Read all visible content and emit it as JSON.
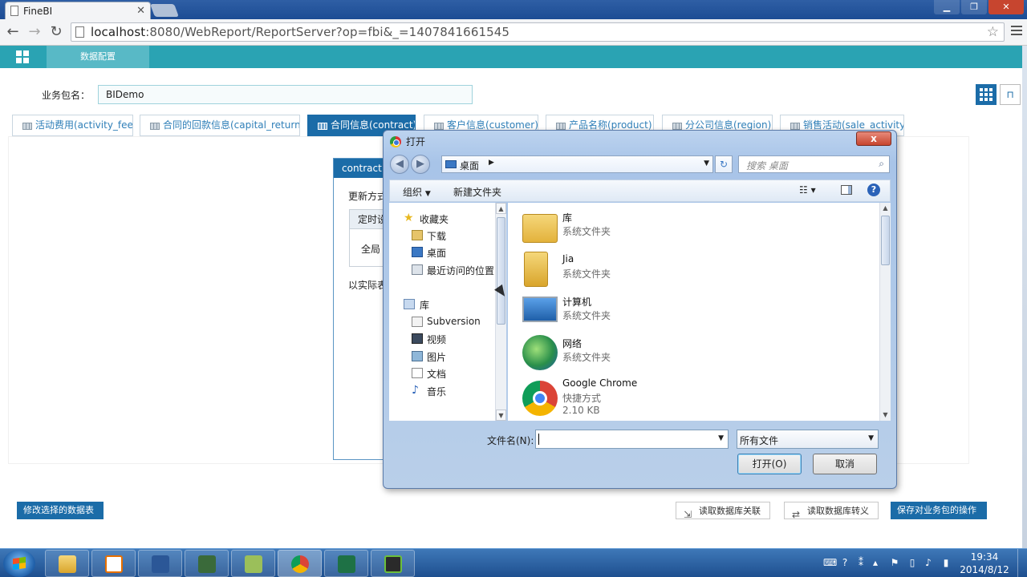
{
  "browser": {
    "tab_title": "FineBI",
    "url_host": "localhost",
    "url_rest": ":8080/WebReport/ReportServer?op=fbi&_=1407841661545"
  },
  "app": {
    "nav_tab": "数据配置",
    "package_label": "业务包名：",
    "package_name": "BIDemo",
    "table_tabs": [
      "活动费用(activity_fee)",
      "合同的回款信息(capital_return)",
      "合同信息(contract)",
      "客户信息(customer)",
      "产品名称(product)",
      "分公司信息(region)",
      "销售活动(sale_activity)"
    ],
    "active_tab_index": 2,
    "panel": {
      "header": "contract",
      "update_label": "更新方式",
      "box_header": "定时设",
      "box_body": "全局",
      "note": "以实际表"
    },
    "footer": {
      "modify_tables": "修改选择的数据表",
      "read_relations": "读取数据库关联",
      "read_escapes": "读取数据库转义",
      "save_ops": "保存对业务包的操作"
    }
  },
  "dialog": {
    "title": "打开",
    "close": "x",
    "path": "桌面",
    "search_placeholder": "搜索 桌面",
    "organize": "组织",
    "new_folder": "新建文件夹",
    "nav_pane": {
      "favorites": "收藏夹",
      "downloads": "下载",
      "desktop": "桌面",
      "recent": "最近访问的位置",
      "libraries": "库",
      "subversion": "Subversion",
      "videos": "视频",
      "pictures": "图片",
      "documents": "文档",
      "music": "音乐"
    },
    "files": [
      {
        "name": "库",
        "type": "系统文件夹",
        "icon": "library-folder-icon"
      },
      {
        "name": "Jia",
        "type": "系统文件夹",
        "icon": "user-folder-icon"
      },
      {
        "name": "计算机",
        "type": "系统文件夹",
        "icon": "computer-icon"
      },
      {
        "name": "网络",
        "type": "系统文件夹",
        "icon": "network-icon"
      },
      {
        "name": "Google Chrome",
        "type": "快捷方式",
        "size": "2.10 KB",
        "icon": "chrome-shortcut-icon"
      }
    ],
    "filename_label": "文件名(N):",
    "filename_value": "",
    "filter": "所有文件",
    "open_button": "打开(O)",
    "cancel_button": "取消"
  },
  "taskbar": {
    "time": "19:34",
    "date": "2014/8/12",
    "apps": [
      "explorer-icon",
      "java-icon",
      "word-icon",
      "terminal-icon",
      "notepad-icon",
      "chrome-icon",
      "excel-icon",
      "archive-icon"
    ]
  }
}
